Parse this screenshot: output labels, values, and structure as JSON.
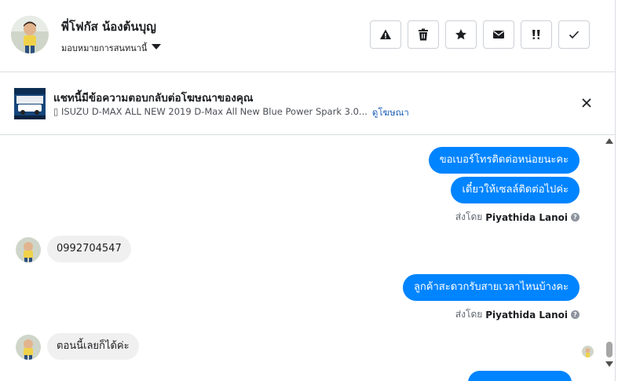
{
  "header": {
    "contact_name": "พี่โฟกัส น้องต้นบุญ",
    "assign_label": "มอบหมายการสนทนานี้",
    "actions": [
      {
        "icon": "warning-icon",
        "label": "spam"
      },
      {
        "icon": "trash-icon",
        "label": "delete"
      },
      {
        "icon": "star-icon",
        "label": "star"
      },
      {
        "icon": "envelope-icon",
        "label": "unread"
      },
      {
        "icon": "follow-up-icon",
        "label": "follow-up"
      },
      {
        "icon": "checkmark-icon",
        "label": "done"
      }
    ]
  },
  "ad_notice": {
    "title": "แชทนี้มีข้อความตอบกลับต่อโฆษณาของคุณ",
    "ad_text": "▯ ISUZU D-MAX ALL NEW 2019 D-Max All New Blue Power Spark 3.0...",
    "link_label": "ดูโฆษณา"
  },
  "messages": [
    {
      "direction": "out",
      "text": "ขอเบอร์โทรติดต่อหน่อยนะคะ"
    },
    {
      "direction": "out",
      "text": "เดี๋ยวให้เซลล์ติดต่อไปค่ะ"
    },
    {
      "sent_by_prefix": "ส่งโดย",
      "sent_by_name": "Piyathida Lanoi"
    },
    {
      "direction": "in",
      "text": "0992704547"
    },
    {
      "direction": "out",
      "text": "ลูกค้าสะดวกรับสายเวลาไหนบ้างคะ"
    },
    {
      "sent_by_prefix": "ส่งโดย",
      "sent_by_name": "Piyathida Lanoi"
    },
    {
      "direction": "in",
      "text": "ตอนนี้เลยก็ได้ค่ะ"
    }
  ],
  "colors": {
    "outgoing_bubble": "#0084ff",
    "incoming_bubble": "#f1f0f0",
    "link": "#1d5fb8"
  }
}
